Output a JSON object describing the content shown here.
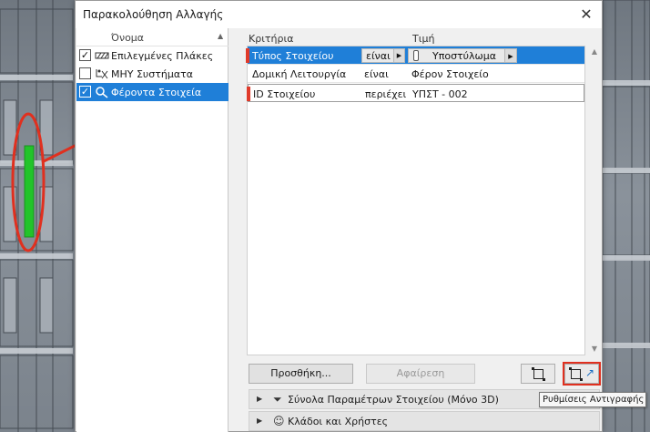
{
  "dialog": {
    "title": "Παρακολούθηση Αλλαγής",
    "close_glyph": "✕"
  },
  "left_list": {
    "column_label": "Όνομα",
    "sort_glyph": "▲",
    "items": [
      {
        "label": "Επιλεγμένες Πλάκες",
        "checked": true,
        "icon": "slab-hatch-icon",
        "selected": false
      },
      {
        "label": "ΜΗΥ Συστήματα",
        "checked": false,
        "icon": "mep-systems-icon",
        "selected": false
      },
      {
        "label": "Φέροντα Στοιχεία",
        "checked": true,
        "icon": "structural-elements-icon",
        "selected": true
      }
    ]
  },
  "criteria": {
    "headers": {
      "criterion": "Κριτήρια",
      "value": "Τιμή"
    },
    "rows": [
      {
        "criterion": "Τύπος Στοιχείου",
        "operator": "είναι",
        "value": "Υποστύλωμα",
        "selected": true
      },
      {
        "criterion": "Δομική Λειτουργία",
        "operator": "είναι",
        "value": "Φέρον Στοιχείο",
        "selected": false
      },
      {
        "criterion": "ID Στοιχείου",
        "operator": "περιέχει",
        "value": "ΥΠΣΤ - 002",
        "selected": false
      }
    ]
  },
  "buttons": {
    "add": "Προσθήκη...",
    "remove": "Αφαίρεση"
  },
  "panels": [
    {
      "label": "Σύνολα Παραμέτρων Στοιχείου (Μόνο 3D)",
      "icon": "filter-icon"
    },
    {
      "label": "Κλάδοι και Χρήστες",
      "icon": "user-icon"
    }
  ],
  "tooltip": "Ρυθμίσεις Αντιγραφής",
  "colors": {
    "selection": "#1f7fd8",
    "annotation_red": "#e0301f",
    "column_green": "#22c42a"
  }
}
